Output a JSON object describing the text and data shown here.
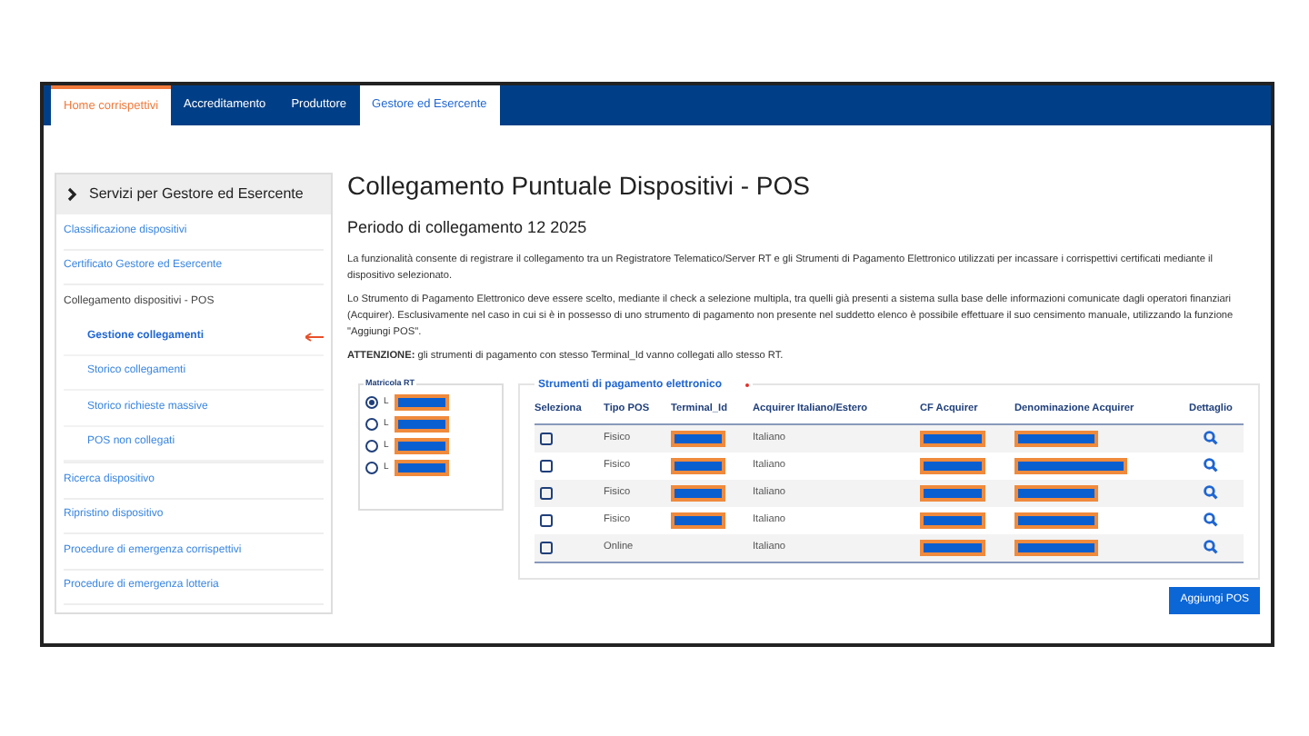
{
  "tabs": [
    {
      "label": "Home corrispettivi",
      "kind": "home",
      "selected": false
    },
    {
      "label": "Accreditamento",
      "kind": "section",
      "selected": false
    },
    {
      "label": "Produttore",
      "kind": "section",
      "selected": false
    },
    {
      "label": "Gestore ed Esercente",
      "kind": "section",
      "selected": true
    }
  ],
  "sidebar": {
    "title": "Servizi per Gestore ed Esercente",
    "items": [
      {
        "label": "Classificazione dispositivi",
        "kind": "link"
      },
      {
        "label": "Certificato Gestore ed Esercente",
        "kind": "link"
      },
      {
        "label": "Collegamento dispositivi - POS",
        "kind": "group",
        "children": [
          {
            "label": "Gestione collegamenti",
            "selected": true,
            "pointer": true
          },
          {
            "label": "Storico collegamenti",
            "selected": false,
            "pointer": false
          },
          {
            "label": "Storico richieste massive",
            "selected": false,
            "pointer": false
          },
          {
            "label": "POS non collegati",
            "selected": false,
            "pointer": false
          }
        ]
      },
      {
        "label": "Ricerca dispositivo",
        "kind": "link"
      },
      {
        "label": "Ripristino dispositivo",
        "kind": "link"
      },
      {
        "label": "Procedure di emergenza corrispettivi",
        "kind": "link"
      },
      {
        "label": "Procedure di emergenza lotteria",
        "kind": "link"
      }
    ]
  },
  "page": {
    "title": "Collegamento Puntuale Dispositivi - POS",
    "subtitle": "Periodo di collegamento 12 2025",
    "paragraphs": [
      "La funzionalità consente di registrare il collegamento tra un Registratore Telematico/Server RT e gli Strumenti di Pagamento Elettronico utilizzati per incassare i corrispettivi certificati mediante il dispositivo selezionato.",
      "Lo Strumento di Pagamento Elettronico deve essere scelto, mediante il check a selezione multipla, tra quelli già presenti a sistema sulla base delle informazioni comunicate dagli operatori finanziari (Acquirer). Esclusivamente nel caso in cui si è in possesso di uno strumento di pagamento non presente nel suddetto elenco è possibile effettuare il suo censimento manuale, utilizzando la funzione \"Aggiungi POS\".",
      "**ATTENZIONE:** gli strumenti di pagamento con stesso Terminal_Id vanno collegati allo stesso RT."
    ]
  },
  "matricola": {
    "legend": "Matricola RT",
    "options": [
      {
        "prefix": "L",
        "selected": true,
        "redacted": true
      },
      {
        "prefix": "L",
        "selected": false,
        "redacted": true
      },
      {
        "prefix": "L",
        "selected": false,
        "redacted": true
      },
      {
        "prefix": "L",
        "selected": false,
        "redacted": true
      }
    ]
  },
  "strumenti": {
    "legend": "Strumenti di pagamento elettronico",
    "required": true,
    "columns": [
      "Seleziona",
      "Tipo POS",
      "Terminal_Id",
      "Acquirer Italiano/Estero",
      "CF Acquirer",
      "Denominazione Acquirer",
      "Dettaglio"
    ],
    "rows": [
      {
        "selected": false,
        "tipo": "Fisico",
        "terminal_redacted": true,
        "acquirer": "Italiano",
        "cf_redacted": true,
        "den_redacted": true
      },
      {
        "selected": false,
        "tipo": "Fisico",
        "terminal_redacted": true,
        "acquirer": "Italiano",
        "cf_redacted": true,
        "den_redacted": true
      },
      {
        "selected": false,
        "tipo": "Fisico",
        "terminal_redacted": true,
        "acquirer": "Italiano",
        "cf_redacted": true,
        "den_redacted": true
      },
      {
        "selected": false,
        "tipo": "Fisico",
        "terminal_redacted": true,
        "acquirer": "Italiano",
        "cf_redacted": true,
        "den_redacted": true
      },
      {
        "selected": false,
        "tipo": "Online",
        "terminal_redacted": false,
        "acquirer": "Italiano",
        "cf_redacted": true,
        "den_redacted": true
      }
    ]
  },
  "add_button": "Aggiungi POS"
}
